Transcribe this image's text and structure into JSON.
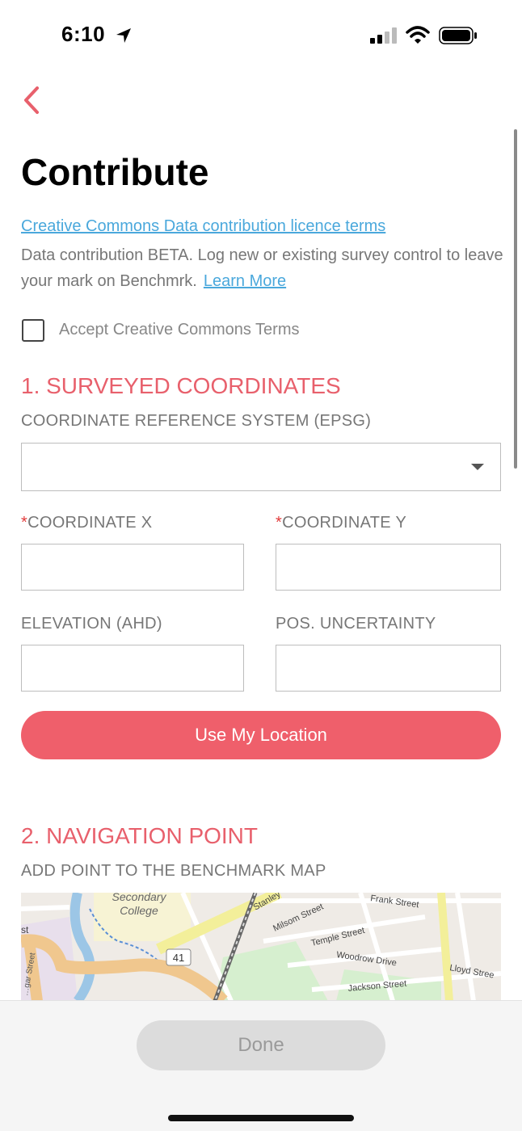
{
  "status_bar": {
    "time": "6:10"
  },
  "header": {
    "title": "Contribute"
  },
  "intro": {
    "licence_link": "Creative Commons Data contribution licence terms",
    "description": "Data contribution BETA. Log new or existing survey control to leave your mark on Benchmrk.",
    "learn_more": "Learn More"
  },
  "terms": {
    "label": "Accept Creative Commons Terms",
    "checked": false
  },
  "section1": {
    "title": "1. SURVEYED COORDINATES",
    "crs_label": "COORDINATE REFERENCE SYSTEM (EPSG)",
    "crs_value": "",
    "required_marker": "*",
    "coord_x_label": "COORDINATE X",
    "coord_y_label": "COORDINATE Y",
    "elevation_label": "ELEVATION (AHD)",
    "uncertainty_label": "POS. UNCERTAINTY",
    "use_location_button": "Use My Location"
  },
  "section2": {
    "title": "2. NAVIGATION POINT",
    "subtitle": "ADD POINT TO THE BENCHMARK MAP",
    "map_labels": {
      "college_line1": "Secondary",
      "college_line2": "College",
      "route": "41",
      "st_left": "st",
      "street_left": "…gar Street",
      "stanley": "Stanley",
      "milsom": "Milsom Street",
      "frank": "Frank Street",
      "temple": "Temple Street",
      "woodrow": "Woodrow Drive",
      "lloyd": "Lloyd Stree",
      "jackson": "Jackson Street"
    }
  },
  "footer": {
    "done_button": "Done"
  },
  "colors": {
    "accent": "#ef5f6b",
    "link": "#4aa8dc",
    "section_title": "#e8606c"
  }
}
